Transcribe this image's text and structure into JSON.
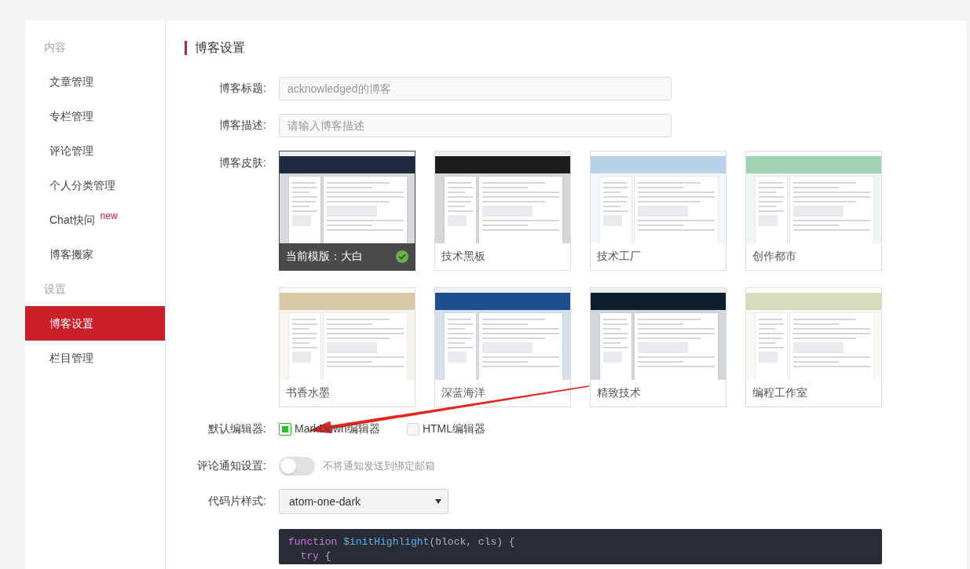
{
  "sidebar": {
    "groups": [
      {
        "title": "内容",
        "items": [
          {
            "label": "文章管理",
            "selected": false
          },
          {
            "label": "专栏管理",
            "selected": false
          },
          {
            "label": "评论管理",
            "selected": false
          },
          {
            "label": "个人分类管理",
            "selected": false
          },
          {
            "label": "Chat快问",
            "badge": "new",
            "selected": false
          },
          {
            "label": "博客搬家",
            "selected": false
          }
        ]
      },
      {
        "title": "设置",
        "items": [
          {
            "label": "博客设置",
            "selected": true
          },
          {
            "label": "栏目管理",
            "selected": false
          }
        ]
      }
    ]
  },
  "section_title": "博客设置",
  "fields": [
    {
      "label": "博客标题:",
      "placeholder": "acknowledged的博客"
    },
    {
      "label": "博客描述:",
      "placeholder": "请输入博客描述"
    }
  ],
  "skins": {
    "label": "博客皮肤:",
    "items": [
      {
        "name": "当前模版：大白",
        "selected": true,
        "color": "#1e2a3d"
      },
      {
        "name": "技术黑板",
        "selected": false,
        "color": "#1c1c1c"
      },
      {
        "name": "技术工厂",
        "selected": false,
        "color": "#b9d2ea"
      },
      {
        "name": "创作都市",
        "selected": false,
        "color": "#9fd3b4"
      },
      {
        "name": "书香水墨",
        "selected": false,
        "color": "#d9c9a8"
      },
      {
        "name": "深蓝海洋",
        "selected": false,
        "color": "#1d4f8f"
      },
      {
        "name": "精致技术",
        "selected": false,
        "color": "#0f1e2e"
      },
      {
        "name": "编程工作室",
        "selected": false,
        "color": "#d8dcbc"
      }
    ]
  },
  "editor": {
    "label": "默认编辑器:",
    "options": [
      {
        "label": "MarkDown编辑器",
        "checked": true
      },
      {
        "label": "HTML编辑器",
        "checked": false
      }
    ]
  },
  "comment_notify": {
    "label": "评论通知设置:",
    "on": false,
    "hint": "不将通知发送到绑定邮箱"
  },
  "code_style": {
    "label": "代码片样式:",
    "value": "atom-one-dark"
  },
  "code_preview": {
    "lines": [
      [
        {
          "kind": "keyword",
          "text": "function "
        },
        {
          "kind": "title",
          "text": "$initHighlight"
        },
        {
          "kind": "plain",
          "text": "(block, cls) {"
        }
      ],
      [
        {
          "kind": "keyword",
          "text": "  try"
        },
        {
          "kind": "plain",
          "text": " {"
        }
      ]
    ]
  }
}
